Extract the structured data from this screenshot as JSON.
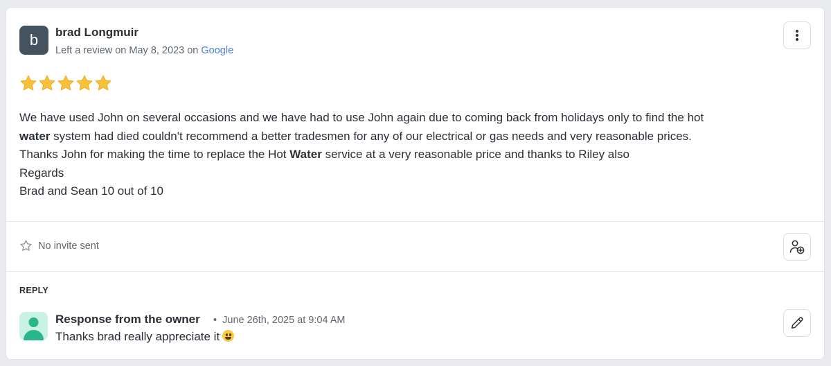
{
  "review": {
    "avatar_letter": "b",
    "author": "brad Longmuir",
    "meta_prefix": "Left a review on May 8, 2023 on ",
    "source": "Google",
    "rating": 5,
    "text_lines": [
      [
        "We have used John on several occasions and we have had to use John again due to coming back from holidays only to find the hot "
      ],
      [
        "",
        "water",
        " system had died couldn't recommend a better tradesmen for any of our electrical or gas needs and very reasonable prices."
      ],
      [
        "Thanks John for making the time to replace the Hot ",
        "Water",
        " service at a very reasonable price and thanks to Riley also"
      ],
      [
        "Regards"
      ],
      [
        "Brad and Sean 10 out of 10"
      ]
    ]
  },
  "invite": {
    "status": "No invite sent"
  },
  "reply": {
    "heading": "REPLY",
    "owner_label": "Response from the owner",
    "date": "June 26th, 2025 at 9:04 AM",
    "text": "Thanks brad really appreciate it"
  },
  "icons": {
    "more": "more-vertical-icon",
    "star": "star-filled-icon",
    "invite_star": "star-outline-icon",
    "invite_user": "user-plus-icon",
    "edit": "pencil-icon",
    "emoji": "grinning-face-emoji"
  },
  "colors": {
    "star": "#f8c13a",
    "avatar_bg": "#45535f",
    "owner_avatar_bg": "#c8f2e3",
    "owner_avatar_fg": "#2bb58c",
    "link": "#4a7fd6"
  }
}
